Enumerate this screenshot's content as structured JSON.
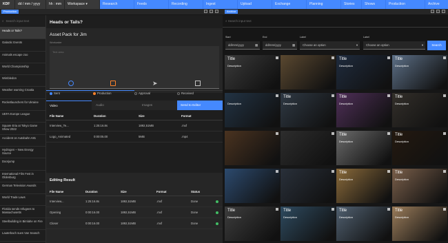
{
  "topbar": {
    "kdf": "KDF",
    "date": "dd / mm / yyyy",
    "time": "hh : mm",
    "workspace": "Workspace",
    "tabs": [
      "Research",
      "Feeds",
      "Recording",
      "Ingest",
      "Upload",
      "Exchange",
      "Planning",
      "Stories",
      "Shows",
      "Production",
      "Archive"
    ]
  },
  "panel_tabs": {
    "left": "Production",
    "right": "Archive"
  },
  "left_list": {
    "search_placeholder": "Search input text",
    "items": [
      "Heads or Tails?",
      "Galactic Events",
      "Animals escape zoo",
      "World Championship",
      "Wimbledon",
      "Weather warning Croatia",
      "Rocketlaunchers for Ukraine",
      "UEFA Europe League",
      "Square Eria at Tokyo Game Show 2022",
      "Accident on Autobahn A81",
      "Hydrogen – New Energy Source",
      "Doorjump",
      "International Film Fest in Oldenburg",
      "German Television Awards",
      "World Trade Laws",
      "Florida sends refugees to Massachusetts",
      "Steelbuilding in Bimlahe on Fire",
      "Lauterbach sues Van Seasch"
    ]
  },
  "middle": {
    "title": "Heads or Tails?",
    "asset_pack": "Asset Pack for Jim",
    "workorder_label": "Workorder",
    "text_area_placeholder": "Text area",
    "steps": [
      "Sent",
      "Production",
      "Approval",
      "Received"
    ],
    "media_tabs": [
      "Video",
      "Audio",
      "Images"
    ],
    "send_button": "Send to Editor",
    "video_table": {
      "headers": [
        "File Name",
        "Duration",
        "Size",
        "Format"
      ],
      "rows": [
        [
          "Interview_Te...",
          "1:25:16.8s",
          "1892,51MB",
          ".mxf"
        ],
        [
          "Logo_Animated",
          "0:00:05.00",
          "5MB",
          ".mp4"
        ]
      ]
    },
    "editing_title": "Editing Result",
    "edit_table": {
      "headers": [
        "File Name",
        "Duration",
        "Size",
        "Format",
        "Status"
      ],
      "rows": [
        [
          "Interview...",
          "1:25:16.8s",
          "1892,51MB",
          ".mxf",
          "Done"
        ],
        [
          "Opening",
          "0:00:16.00",
          "1892,51MB",
          ".mxf",
          "Done"
        ],
        [
          "Closer",
          "0:00:16.00",
          "1892,51MB",
          ".mxf",
          "Done"
        ]
      ]
    }
  },
  "right": {
    "search_placeholder": "Search input text",
    "start_label": "Start",
    "end_label": "End",
    "label1": "Label",
    "label2": "Label",
    "start_value": "dd/mm/yyyy",
    "end_value": "dd/mm/yyyy",
    "select1": "Choose an option",
    "select2": "Choose an option",
    "search_button": "Search",
    "tile_title": "Title",
    "tile_desc": "Description",
    "tile_colors": [
      "#3a3a3a",
      "#5a4830",
      "#1f2b3d",
      "#5c6f86",
      "#223344",
      "#2f3944",
      "#4f2f58",
      "#332f2a",
      "#4a3320",
      "#2d2d2d",
      "#6b6b6b",
      "#24190f",
      "#2c4a6e",
      "#29303a",
      "#8a6a3a",
      "#7a5f4a",
      "#3d3d3d",
      "#2e4a5f",
      "#506070",
      "#9a7c5a"
    ]
  },
  "colors": {
    "accent": "#4589ff",
    "status_done": "#42be65"
  }
}
